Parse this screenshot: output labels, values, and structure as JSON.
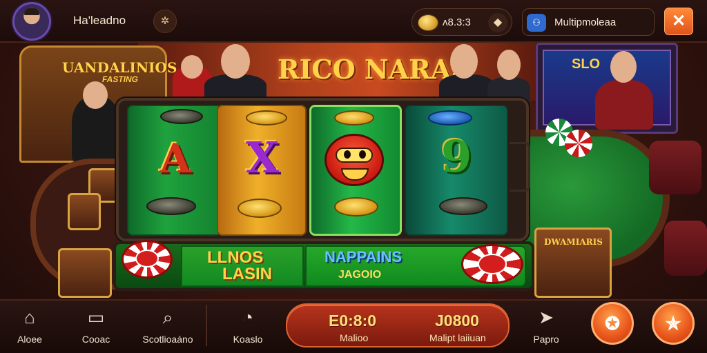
{
  "header": {
    "player_name": "Ha'leadno",
    "bonus_icon_glyph": "✲",
    "coin_balance": "ʌ8.3:3",
    "coin_add_glyph": "◆",
    "mode_icon_glyph": "⚇",
    "mode_label": "Multipmoleaa",
    "close_glyph": "✕"
  },
  "scene": {
    "banner_title": "RICO NARAS",
    "left_machine_title": "UANDALINIOS",
    "left_machine_subtitle": "FASTING",
    "arcade_title": "SLO",
    "right_card_title": "DWAMIARIS"
  },
  "reels": {
    "reel1_symbol": "A",
    "reel2_symbol": "X",
    "reel4_symbol": "9"
  },
  "win_row": {
    "left_title": "LLNOS",
    "left_subtitle": "LASIN",
    "right_title": "NAPPAINS",
    "right_subtitle": "JAGOIO"
  },
  "footer": {
    "nav": [
      {
        "label": "Aloee",
        "icon": "home-icon",
        "glyph": "⌂"
      },
      {
        "label": "Cooac",
        "icon": "wallet-icon",
        "glyph": "▭"
      },
      {
        "label": "Scotlioaáno",
        "icon": "search-icon",
        "glyph": "⌕"
      },
      {
        "label": "Koaslo",
        "icon": "clock-icon",
        "glyph": "◔"
      },
      {
        "label": "Papro",
        "icon": "send-icon",
        "glyph": "➤"
      }
    ],
    "stats": [
      {
        "value": "E0:8:0",
        "label": "Malioo"
      },
      {
        "value": "J0800",
        "label": "Malipt laiiuan"
      }
    ],
    "action_1_glyph": "✪",
    "action_2_glyph": "✯"
  },
  "colors": {
    "accent_orange": "#e8541a",
    "reel_green": "#1fa23e",
    "reel_gold": "#f0b02a",
    "banner_gold": "#ffd24a"
  }
}
